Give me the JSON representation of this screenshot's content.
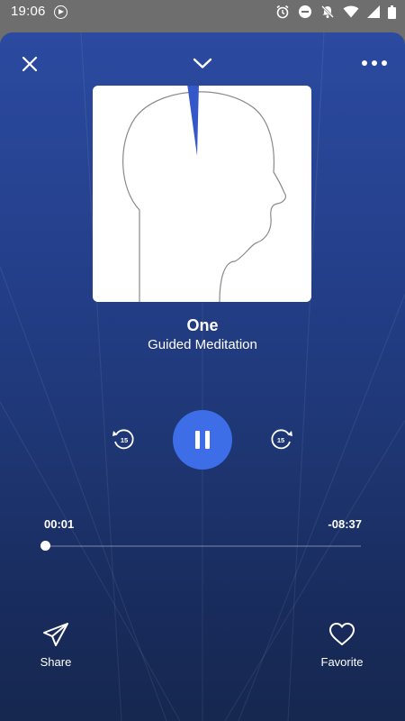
{
  "status_bar": {
    "time": "19:06",
    "icons": [
      "play-circle-icon",
      "alarm-icon",
      "do-not-disturb-icon",
      "notifications-off-icon",
      "wifi-icon",
      "signal-icon",
      "battery-icon"
    ]
  },
  "header": {
    "close_icon": "close-icon",
    "collapse_icon": "chevron-down-icon",
    "more_icon": "more-horizontal-icon"
  },
  "track": {
    "title": "One",
    "subtitle": "Guided Meditation"
  },
  "controls": {
    "rewind_seconds": "15",
    "forward_seconds": "15",
    "state_icon": "pause-icon"
  },
  "progress": {
    "elapsed": "00:01",
    "remaining": "-08:37",
    "fraction": 0.002
  },
  "actions": {
    "share_label": "Share",
    "favorite_label": "Favorite"
  },
  "colors": {
    "accent": "#3d6ee8",
    "background_top": "#2b4aa0",
    "background_bottom": "#16284f",
    "status_bar": "#6e6e6e"
  }
}
